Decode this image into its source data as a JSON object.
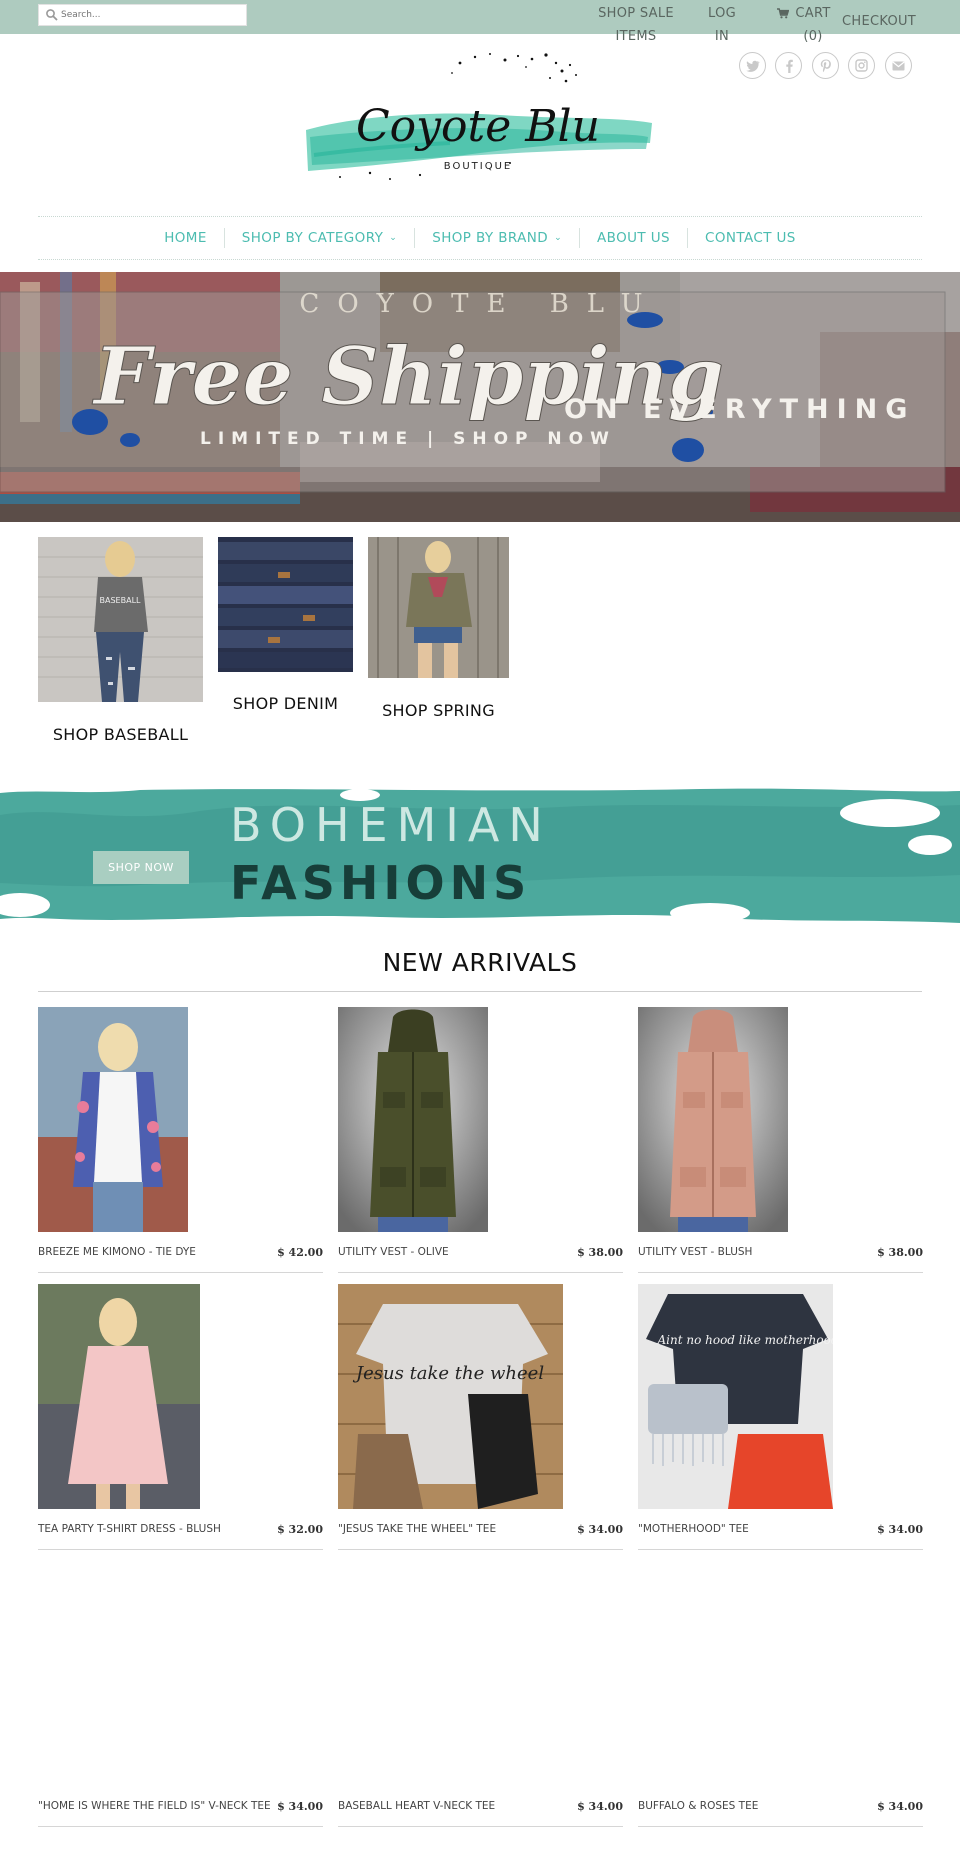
{
  "header": {
    "search_placeholder": "Search...",
    "links": {
      "shop_sale_line1": "SHOP SALE",
      "shop_sale_line2": "ITEMS",
      "login_line1": "LOG",
      "login_line2": "IN",
      "cart_line1": "CART",
      "cart_line2": "(0)",
      "checkout": "CHECKOUT"
    },
    "social_icons": [
      "twitter-icon",
      "facebook-icon",
      "pinterest-icon",
      "instagram-icon",
      "email-icon"
    ]
  },
  "logo": {
    "brand": "Coyote Blu",
    "sub": "BOUTIQUE"
  },
  "nav": {
    "items": [
      {
        "label": "HOME",
        "dropdown": false
      },
      {
        "label": "SHOP BY CATEGORY",
        "dropdown": true
      },
      {
        "label": "SHOP BY BRAND",
        "dropdown": true
      },
      {
        "label": "ABOUT US",
        "dropdown": false
      },
      {
        "label": "CONTACT US",
        "dropdown": false
      }
    ]
  },
  "hero": {
    "headline": "Free Shipping",
    "tagline": "ON EVERYTHING",
    "subline": "LIMITED TIME | SHOP NOW",
    "sign_text": "COYOTE BLU"
  },
  "categories": [
    {
      "label": "SHOP BASEBALL"
    },
    {
      "label": "SHOP DENIM"
    },
    {
      "label": "SHOP SPRING"
    }
  ],
  "boho": {
    "line1": "BOHEMIAN",
    "line2": "FASHIONS",
    "button": "SHOP NOW"
  },
  "new_arrivals": {
    "title": "NEW ARRIVALS",
    "products": [
      {
        "name": "BREEZE ME KIMONO - TIE DYE",
        "price": "$ 42.00"
      },
      {
        "name": "UTILITY VEST - OLIVE",
        "price": "$ 38.00"
      },
      {
        "name": "UTILITY VEST - BLUSH",
        "price": "$ 38.00"
      },
      {
        "name": "TEA PARTY T-SHIRT DRESS - BLUSH",
        "price": "$ 32.00"
      },
      {
        "name": "\"JESUS TAKE THE WHEEL\" TEE",
        "price": "$ 34.00"
      },
      {
        "name": "\"MOTHERHOOD\" TEE",
        "price": "$ 34.00"
      },
      {
        "name": "\"HOME IS WHERE THE FIELD IS\" V-NECK TEE",
        "price": "$ 34.00"
      },
      {
        "name": "BASEBALL HEART V-NECK TEE",
        "price": "$ 34.00"
      },
      {
        "name": "BUFFALO & ROSES TEE",
        "price": "$ 34.00"
      }
    ],
    "shirt_texts": {
      "jesus": "Jesus take the wheel",
      "mother": "Aint no hood like motherhood"
    }
  },
  "colors": {
    "topbar": "#aecbbf",
    "accent": "#4cbcb0",
    "teal": "#4ca99d",
    "boho_button": "#a9cec1"
  }
}
